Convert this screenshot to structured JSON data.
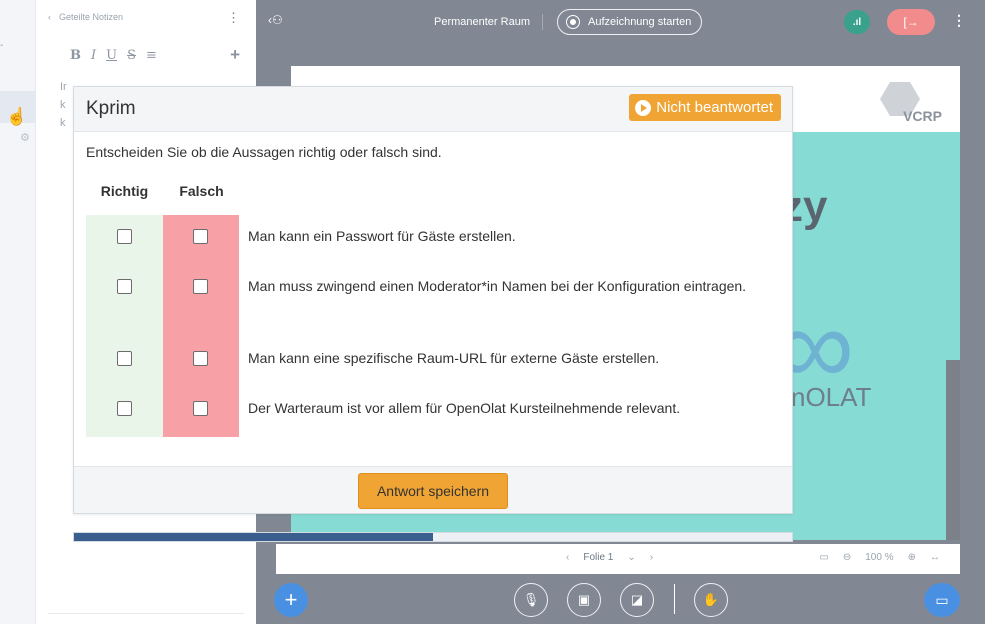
{
  "notes_panel": {
    "title": "Geteilte Notizen",
    "toolbar": {
      "bold": "B",
      "italic": "I",
      "underline": "U",
      "strike": "S",
      "list": "≡",
      "add": "+"
    },
    "hint_lines": [
      "Ir",
      "k",
      "k"
    ]
  },
  "topbar": {
    "room_name": "Permanenter Raum",
    "record_label": "Aufzeichnung starten"
  },
  "slide": {
    "logo_text": "VCRP",
    "big_word": "zy",
    "brand_text": "nOLAT"
  },
  "slide_nav": {
    "slide_label": "Folie 1",
    "zoom": "100 %"
  },
  "quiz": {
    "title": "Kprim",
    "status": "Nicht beantwortet",
    "instruction": "Entscheiden Sie ob die Aussagen richtig oder falsch sind.",
    "col_true": "Richtig",
    "col_false": "Falsch",
    "statements": [
      "Man kann ein Passwort für Gäste erstellen.",
      "Man muss zwingend einen Moderator*in Namen bei der Konfiguration eintragen.",
      "Man kann eine spezifische Raum-URL für externe Gäste erstellen.",
      "Der Warteraum ist vor allem für OpenOlat Kursteilnehmende relevant."
    ],
    "save_label": "Antwort speichern",
    "progress_fraction": 0.5
  },
  "colors": {
    "accent_orange": "#f0a433",
    "progress_blue": "#3a5f8f",
    "true_col": "#e9f5e9",
    "false_col": "#f7a1a6",
    "stage_gray": "#818894",
    "slide_teal": "#86dcd5"
  }
}
